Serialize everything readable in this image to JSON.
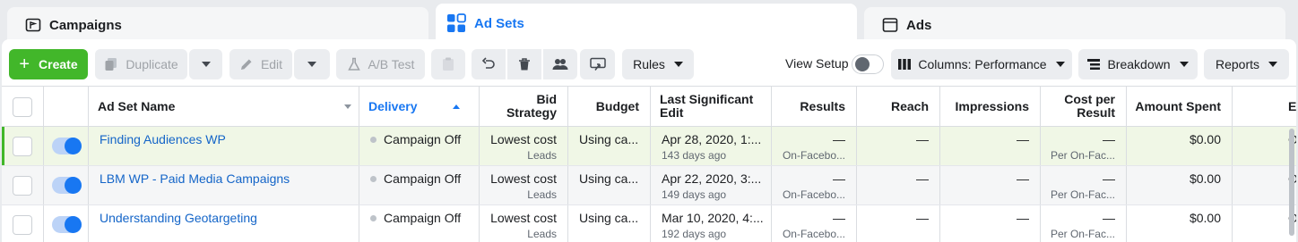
{
  "tabs": {
    "campaigns": "Campaigns",
    "adsets": "Ad Sets",
    "ads": "Ads"
  },
  "toolbar": {
    "create": "Create",
    "duplicate": "Duplicate",
    "edit": "Edit",
    "ab_test": "A/B Test",
    "rules": "Rules",
    "view_setup": "View Setup",
    "columns": "Columns: Performance",
    "breakdown": "Breakdown",
    "reports": "Reports"
  },
  "table": {
    "headers": {
      "name": "Ad Set Name",
      "delivery": "Delivery",
      "bid": "Bid Strategy",
      "budget": "Budget",
      "edit": "Last Significant Edit",
      "results": "Results",
      "reach": "Reach",
      "impressions": "Impressions",
      "cpr": "Cost per Result",
      "amount": "Amount Spent",
      "end": "E"
    },
    "rows": [
      {
        "name": "Finding Audiences WP",
        "delivery": "Campaign Off",
        "bid": "Lowest cost",
        "bid_sub": "Leads",
        "budget": "Using ca...",
        "edit": "Apr 28, 2020, 1:...",
        "edit_sub": "143 days ago",
        "results": "—",
        "results_sub": "On-Facebo...",
        "reach": "—",
        "impressions": "—",
        "cpr": "—",
        "cpr_sub": "Per On-Fac...",
        "amount": "$0.00",
        "end": "Or"
      },
      {
        "name": "LBM WP - Paid Media Campaigns",
        "delivery": "Campaign Off",
        "bid": "Lowest cost",
        "bid_sub": "Leads",
        "budget": "Using ca...",
        "edit": "Apr 22, 2020, 3:...",
        "edit_sub": "149 days ago",
        "results": "—",
        "results_sub": "On-Facebo...",
        "reach": "—",
        "impressions": "—",
        "cpr": "—",
        "cpr_sub": "Per On-Fac...",
        "amount": "$0.00",
        "end": "Or"
      },
      {
        "name": "Understanding Geotargeting",
        "delivery": "Campaign Off",
        "bid": "Lowest cost",
        "bid_sub": "Leads",
        "budget": "Using ca...",
        "edit": "Mar 10, 2020, 4:...",
        "edit_sub": "192 days ago",
        "results": "—",
        "results_sub": "On-Facebo...",
        "reach": "—",
        "impressions": "—",
        "cpr": "—",
        "cpr_sub": "Per On-Fac...",
        "amount": "$0.00",
        "end": "Or"
      }
    ]
  },
  "icons": {
    "campaigns": "folder-flag-icon",
    "adsets": "grid-icon",
    "ads": "window-icon"
  },
  "colors": {
    "accent": "#1877f2",
    "create": "#42b72a",
    "link": "#1465c8"
  }
}
